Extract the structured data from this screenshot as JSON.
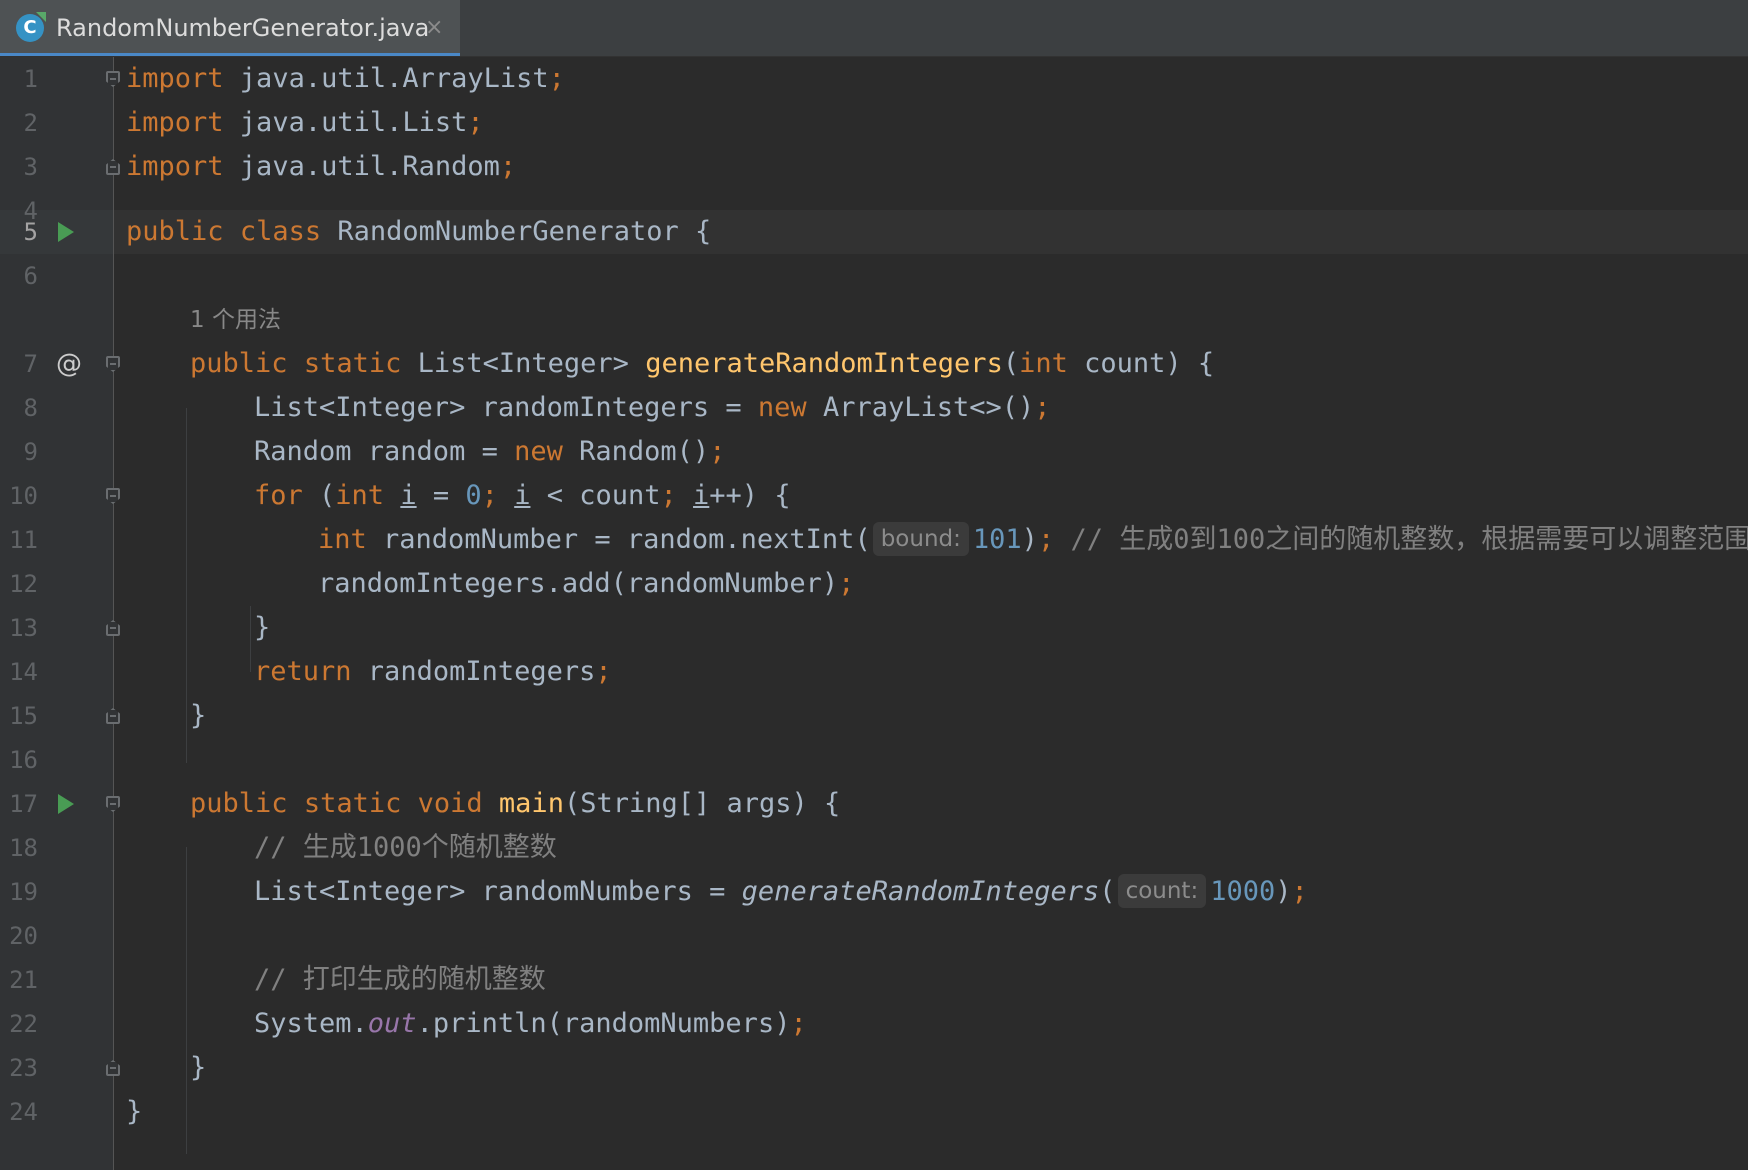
{
  "tab": {
    "icon_letter": "C",
    "title": "RandomNumberGenerator.java",
    "close": "×"
  },
  "code": {
    "current_line": 5,
    "usage_hint": "1 个用法",
    "line_numbers": [
      "1",
      "2",
      "3",
      "4",
      "5",
      "6",
      "7",
      "8",
      "9",
      "10",
      "11",
      "12",
      "13",
      "14",
      "15",
      "16",
      "17",
      "18",
      "19",
      "20",
      "21",
      "22",
      "23",
      "24"
    ],
    "lines": {
      "l1": {
        "kw": "import",
        "rest": " java.util.ArrayList",
        "semi": ";"
      },
      "l2": {
        "kw": "import",
        "rest": " java.util.List",
        "semi": ";"
      },
      "l3": {
        "kw": "import",
        "rest": " java.util.Random",
        "semi": ";"
      },
      "l5": {
        "kw1": "public",
        "kw2": "class",
        "rest": " RandomNumberGenerator {"
      },
      "l7": {
        "kw1": "public",
        "kw2": "static",
        "type": " List<Integer> ",
        "fn": "generateRandomIntegers",
        "p1": "(",
        "kw3": "int",
        "rest": " count) {"
      },
      "l8": {
        "a": "List<Integer> randomIntegers = ",
        "kw": "new",
        "b": " ArrayList<>()",
        "semi": ";"
      },
      "l9": {
        "a": "Random random = ",
        "kw": "new",
        "b": " Random()",
        "semi": ";"
      },
      "l10": {
        "kw1": "for",
        "a": " (",
        "kw2": "int",
        "sp": " ",
        "i1": "i",
        "b": " = ",
        "n": "0",
        "s1": ";",
        "sp2": " ",
        "i2": "i",
        "c": " < count",
        "s2": ";",
        "sp3": " ",
        "i3": "i",
        "d": "++) {"
      },
      "l11": {
        "kw": "int",
        "a": " randomNumber = random.nextInt(",
        "hint": "bound:",
        "n": "101",
        "b": ")",
        "semi": ";",
        "cm": " // 生成0到100之间的随机整数，根据需要可以调整范围"
      },
      "l12": {
        "a": "randomIntegers.add(randomNumber)",
        "semi": ";"
      },
      "l13": {
        "a": "}"
      },
      "l14": {
        "kw": "return",
        "a": " randomIntegers",
        "semi": ";"
      },
      "l15": {
        "a": "}"
      },
      "l17": {
        "kw1": "public",
        "kw2": "static",
        "kw3": "void",
        "fn": "main",
        "rest": "(String[] args) {"
      },
      "l18": {
        "cm": "// 生成1000个随机整数"
      },
      "l19": {
        "a": "List<Integer> randomNumbers = ",
        "fn": "generateRandomIntegers",
        "p": "(",
        "hint": "count:",
        "n": "1000",
        "b": ")",
        "semi": ";"
      },
      "l21": {
        "cm": "// 打印生成的随机整数"
      },
      "l22": {
        "a": "System.",
        "field": "out",
        "b": ".println(randomNumbers)",
        "semi": ";"
      },
      "l23": {
        "a": "}"
      },
      "l24": {
        "a": "}"
      }
    }
  }
}
